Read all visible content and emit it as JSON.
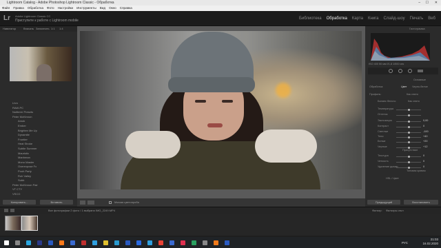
{
  "window": {
    "title": "Lightroom Catalog - Adobe Photoshop Lightroom Classic - Обработка"
  },
  "menu": [
    "Файл",
    "Правка",
    "Обработка",
    "Фото",
    "Настройки",
    "Инструменты",
    "Вид",
    "Окно",
    "Справка"
  ],
  "identity": {
    "logo": "Lr",
    "line1": "Adobe Lightroom Classic CC",
    "line2": "Приступите к работе с Lightroom mobile"
  },
  "modules": [
    "Библиотека",
    "Обработка",
    "Карта",
    "Книга",
    "Слайд-шоу",
    "Печать",
    "Веб"
  ],
  "active_module": "Обработка",
  "left_panel": {
    "navigator_header": "Навигатор",
    "navigator_opts": [
      "Вписать",
      "Заполнить",
      "1:1",
      "1:4"
    ],
    "presets": [
      "Lhm",
      "RAW-PC",
      "Nuitterer Presets",
      "Peter McKinnon",
      "Amok",
      "Ember",
      "Brighten Me Up",
      "Dynamite",
      "Frontier",
      "Heat Stroke",
      "Subtle Summer",
      "Mauristic",
      "Manhman",
      "Mono Master",
      "Overexpose Fx",
      "Pooh Party",
      "Ruh Valley",
      "Subb",
      "Peter McKinnon Pair",
      "VT CTY",
      "VSCO"
    ],
    "buttons": [
      "Копировать...",
      "Вставить"
    ]
  },
  "right_panel": {
    "histogram_title": "Гистограмма",
    "photo_info": "ISO 400    50 мм   f/1,8   1/500 сек",
    "basic_title": "Основные",
    "treatment": [
      "Обработка:",
      "Цвет",
      "Черно-белое"
    ],
    "profile": "Профиль:",
    "profile_value": "Как снято",
    "wb_label": "Баланс белого:",
    "wb_value": "Как снято",
    "sliders": [
      {
        "label": "Температура",
        "value": ""
      },
      {
        "label": "Оттенок",
        "value": ""
      },
      {
        "label": "Экспозиция",
        "value": "0,00"
      },
      {
        "label": "Контраст",
        "value": "0"
      },
      {
        "label": "Светлые",
        "value": "-100"
      },
      {
        "label": "Тени",
        "value": "+40"
      },
      {
        "label": "Белые",
        "value": "+20"
      },
      {
        "label": "Черные",
        "value": "+12"
      },
      {
        "label": "Текстура",
        "value": "0"
      },
      {
        "label": "Четкость",
        "value": "0"
      },
      {
        "label": "Удаление дымки",
        "value": "0"
      }
    ],
    "presence_title": "Присутствие",
    "tone_title": "Тоновая кривая",
    "hsl_title": "HSL / Цвет",
    "buttons": [
      "Предыдущий",
      "Восстановить"
    ]
  },
  "toolbar": {
    "label": "Мягкая цветопроба"
  },
  "filmstrip": {
    "info": "Все фотографии     2 фото / 1 выбрано     IMG_2249.MP4",
    "filter_label": "Фильтр:",
    "filter_value": "Фильтры откл"
  },
  "taskbar": {
    "time": "21:03",
    "date": "16.02.2020",
    "lang": "РУС"
  }
}
